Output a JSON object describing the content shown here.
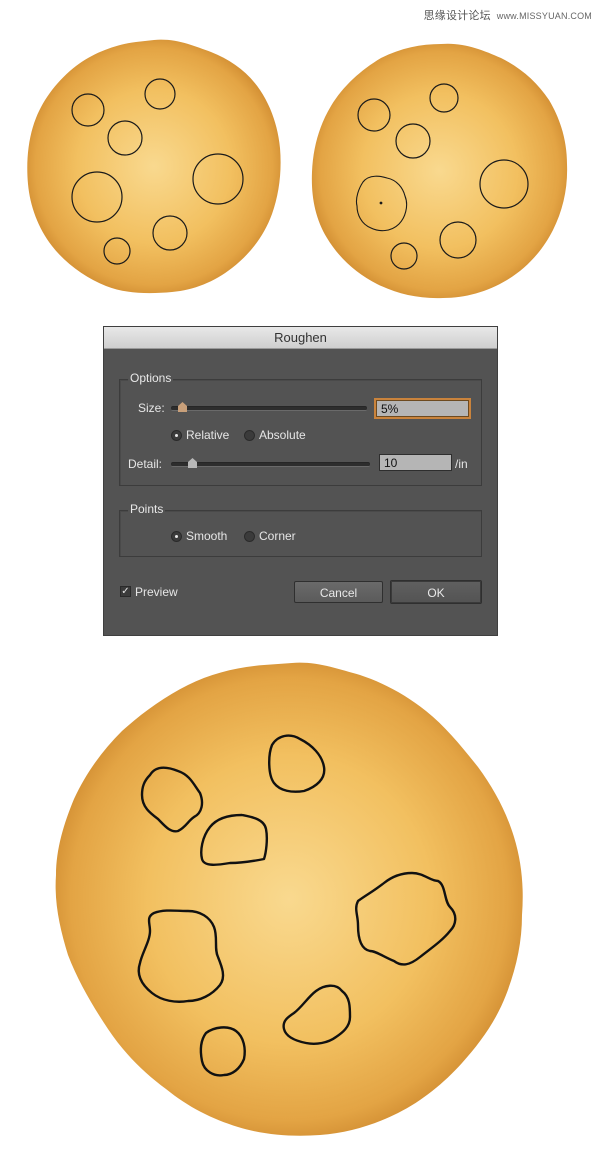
{
  "watermark": {
    "text": "思缘设计论坛",
    "url": "www.MISSYUAN.COM"
  },
  "colors": {
    "cookie_center": "#f9d98f",
    "cookie_mid": "#f2c060",
    "cookie_edge": "#c9832a",
    "dialog_bg": "#535353",
    "focus_ring": "#c9833c"
  },
  "dialog": {
    "title": "Roughen",
    "options": {
      "group_label": "Options",
      "size_label": "Size:",
      "size_value": "5%",
      "size_slider_level": 0.05,
      "relative_label": "Relative",
      "absolute_label": "Absolute",
      "relative_selected": true,
      "detail_label": "Detail:",
      "detail_value": "10",
      "detail_slider_level": 0.1,
      "detail_unit": "/in"
    },
    "points": {
      "group_label": "Points",
      "smooth_label": "Smooth",
      "corner_label": "Corner",
      "smooth_selected": true
    },
    "preview_label": "Preview",
    "preview_checked": true,
    "cancel_label": "Cancel",
    "ok_label": "OK"
  }
}
